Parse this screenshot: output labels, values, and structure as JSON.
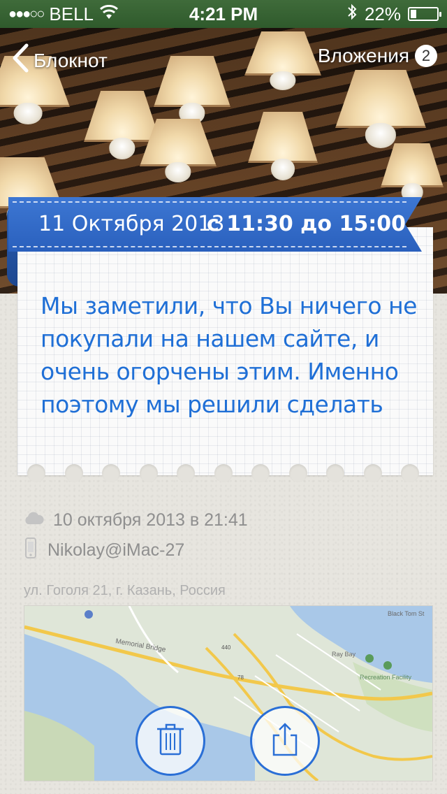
{
  "status_bar": {
    "carrier": "BELL",
    "time": "4:21 PM",
    "battery": "22%",
    "battery_level": 0.22,
    "signal_dots": "●●●○○"
  },
  "nav": {
    "back_label": "Блокнот",
    "attachments_label": "Вложения",
    "attachments_count": "2"
  },
  "ribbon": {
    "date": "11 Октября 2013",
    "time_range": "с 11:30 до 15:00"
  },
  "note": {
    "text_lines": [
      "Мы заметили, что Вы ничего не",
      "покупали на нашем сайте, и",
      "очень огорчены этим. Именно",
      "поэтому мы решили сделать"
    ]
  },
  "meta": {
    "synced_at": "10 октября 2013 в 21:41",
    "device": "Nikolay@iMac-27",
    "address": "ул. Гоголя 21, г. Казань, Россия"
  },
  "map": {
    "labels": [
      "Memorial Bridge",
      "Ray Bay",
      "Recreation Facility",
      "Black Tom St",
      "440",
      "78"
    ]
  },
  "colors": {
    "accent": "#2a6fd6",
    "ribbon": "#3d77d3",
    "status_bar": "#3f6b3a",
    "note_text": "#1f6fd6"
  },
  "icons": {
    "back": "chevron-left-icon",
    "cloud": "cloud-icon",
    "device": "phone-icon",
    "delete": "trash-icon",
    "share": "share-icon",
    "wifi": "wifi-icon",
    "bluetooth": "bluetooth-icon"
  }
}
